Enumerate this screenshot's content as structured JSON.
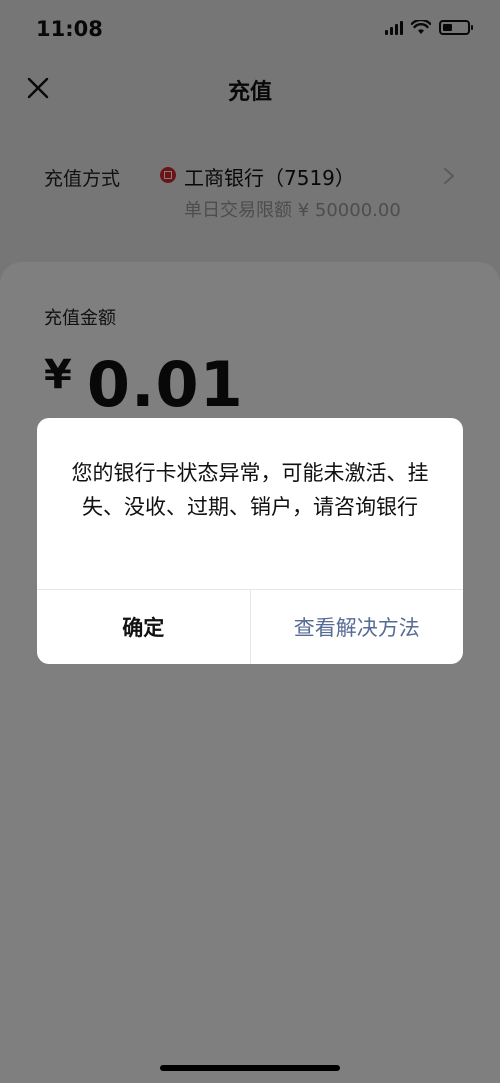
{
  "status_bar": {
    "time": "11:08",
    "icons": [
      "signal-icon",
      "wifi-icon",
      "battery-icon"
    ]
  },
  "nav": {
    "title": "充值",
    "close_icon": "close-icon"
  },
  "payment_method": {
    "label": "充值方式",
    "bank_name": "工商银行（7519）",
    "limit_text": "单日交易限额 ¥ 50000.00",
    "bank_icon": "icbc-logo-icon",
    "chevron_icon": "chevron-right-icon"
  },
  "amount": {
    "label": "充值金额",
    "currency": "¥",
    "value": "0.01"
  },
  "dialog": {
    "message": "您的银行卡状态异常，可能未激活、挂失、没收、过期、销户，请咨询银行",
    "confirm_label": "确定",
    "solution_label": "查看解决方法"
  },
  "colors": {
    "link_blue": "#576b95",
    "bank_red": "#d9262c",
    "page_bg": "#ededed"
  }
}
